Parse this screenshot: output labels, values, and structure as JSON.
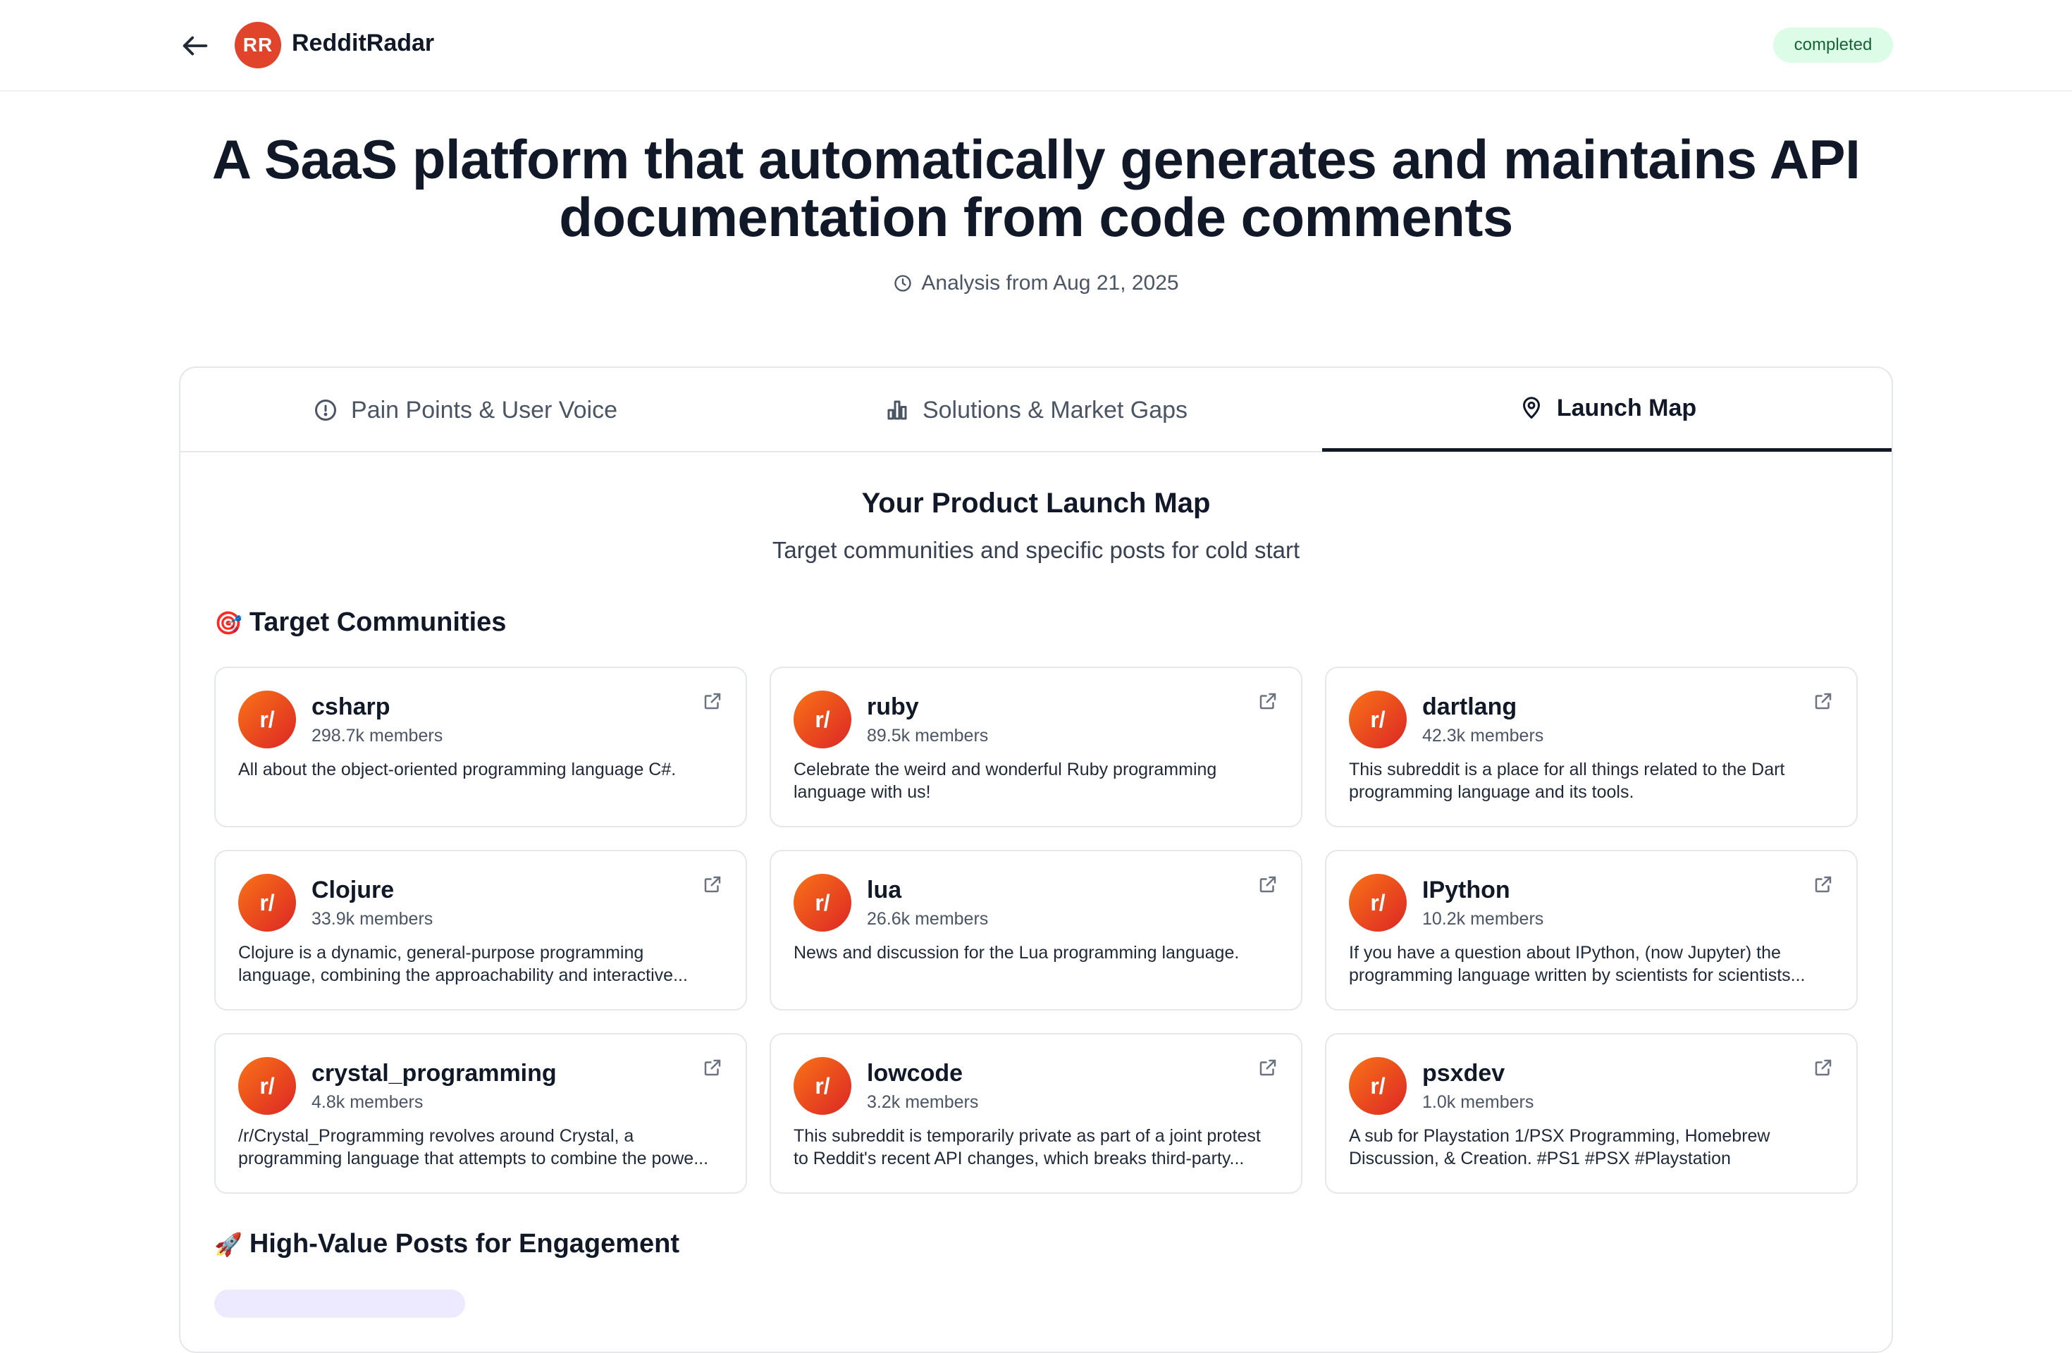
{
  "header": {
    "brand_initials": "RR",
    "brand_name": "RedditRadar",
    "status": "completed"
  },
  "hero": {
    "title": "A SaaS platform that automatically generates and maintains API documentation from code comments",
    "analysis_date": "Analysis from Aug 21, 2025"
  },
  "tabs": [
    {
      "label": "Pain Points & User Voice",
      "icon": "alert-circle-icon",
      "active": false
    },
    {
      "label": "Solutions & Market Gaps",
      "icon": "bar-chart-icon",
      "active": false
    },
    {
      "label": "Launch Map",
      "icon": "map-pin-icon",
      "active": true
    }
  ],
  "launch_map": {
    "title": "Your Product Launch Map",
    "subtitle": "Target communities and specific posts for cold start",
    "communities_title": "Target Communities",
    "communities_emoji": "🎯",
    "posts_title": "High-Value Posts for Engagement",
    "posts_emoji": "🚀",
    "communities": [
      {
        "avatar": "r/",
        "name": "csharp",
        "members": "298.7k members",
        "description": "All about the object-oriented programming language C#."
      },
      {
        "avatar": "r/",
        "name": "ruby",
        "members": "89.5k members",
        "description": "Celebrate the weird and wonderful Ruby programming language with us!"
      },
      {
        "avatar": "r/",
        "name": "dartlang",
        "members": "42.3k members",
        "description": "This subreddit is a place for all things related to the Dart programming language and its tools."
      },
      {
        "avatar": "r/",
        "name": "Clojure",
        "members": "33.9k members",
        "description": "Clojure is a dynamic, general-purpose programming language, combining the approachability and interactive..."
      },
      {
        "avatar": "r/",
        "name": "lua",
        "members": "26.6k members",
        "description": "News and discussion for the Lua programming language."
      },
      {
        "avatar": "r/",
        "name": "IPython",
        "members": "10.2k members",
        "description": "If you have a question about IPython, (now Jupyter) the programming language written by scientists for scientists..."
      },
      {
        "avatar": "r/",
        "name": "crystal_programming",
        "members": "4.8k members",
        "description": "/r/Crystal_Programming revolves around Crystal, a programming language that attempts to combine the powe..."
      },
      {
        "avatar": "r/",
        "name": "lowcode",
        "members": "3.2k members",
        "description": "This subreddit is temporarily private as part of a joint protest to Reddit's recent API changes, which breaks third-party..."
      },
      {
        "avatar": "r/",
        "name": "psxdev",
        "members": "1.0k members",
        "description": "A sub for Playstation 1/PSX Programming, Homebrew Discussion, & Creation. #PS1 #PSX #Playstation"
      }
    ]
  }
}
